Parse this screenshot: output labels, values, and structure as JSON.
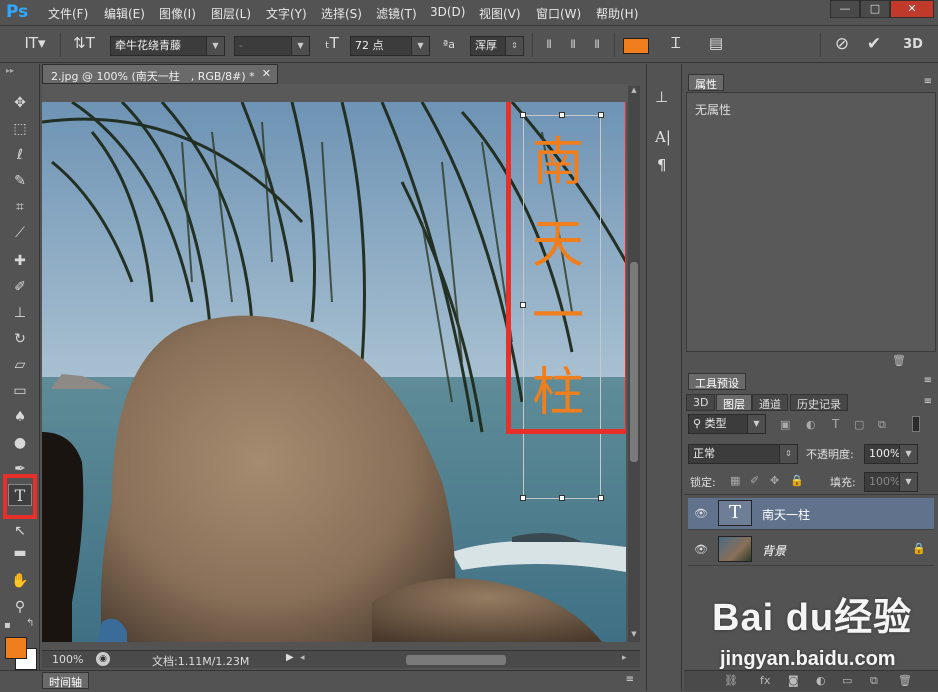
{
  "menu": [
    "文件(F)",
    "编辑(E)",
    "图像(I)",
    "图层(L)",
    "文字(Y)",
    "选择(S)",
    "滤镜(T)",
    "3D(D)",
    "视图(V)",
    "窗口(W)",
    "帮助(H)"
  ],
  "app_logo": "Ps",
  "window_controls": {
    "minimize": "—",
    "restore": "□",
    "close": "✕"
  },
  "options": {
    "font_family": "牵牛花绕青藤",
    "font_style": "-",
    "font_size": "72 点",
    "aa_label": "ªa",
    "aa_mode": "浑厚",
    "text_color": "#f07e1c",
    "mode_3d": "3D"
  },
  "document": {
    "tab_title": "2.jpg @ 100% (南天一柱　, RGB/8#) *",
    "text_content": [
      "南",
      "天",
      "一",
      "柱"
    ],
    "zoom": "100%",
    "doc_info": "文档:1.11M/1.23M"
  },
  "timeline_label": "时间轴",
  "properties": {
    "tab": "属性",
    "empty": "无属性"
  },
  "tool_presets_tab": "工具预设",
  "layers_panel": {
    "tabs": [
      "3D",
      "图层",
      "通道",
      "历史记录"
    ],
    "filter_kind": "类型",
    "blend_mode": "正常",
    "opacity_label": "不透明度:",
    "opacity_value": "100%",
    "lock_label": "锁定:",
    "fill_label": "填充:",
    "fill_value": "100%",
    "layers": [
      {
        "name": "南天一柱",
        "type": "text"
      },
      {
        "name": "背景",
        "type": "image"
      }
    ]
  },
  "watermark": {
    "brand": "Bai du经验",
    "url": "jingyan.baidu.com"
  },
  "colors": {
    "foreground": "#f07e1c",
    "background": "#ffffff",
    "highlight": "#e8302a"
  }
}
